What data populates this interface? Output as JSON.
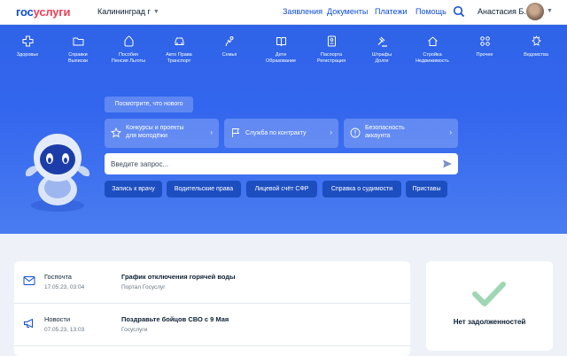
{
  "header": {
    "logo_part1": "гос",
    "logo_part2": "услуги",
    "city": "Калининград г",
    "nav": [
      "Заявления",
      "Документы",
      "Платежи",
      "Помощь"
    ],
    "user_name": "Анастасия Б."
  },
  "categories": [
    {
      "label": "Здоровье",
      "icon": "health-icon"
    },
    {
      "label": "Справки\nВыписки",
      "icon": "folder-icon"
    },
    {
      "label": "Пособия\nПенсия Льготы",
      "icon": "bag-icon"
    },
    {
      "label": "Авто Права\nТранспорт",
      "icon": "car-icon"
    },
    {
      "label": "Семья",
      "icon": "family-icon"
    },
    {
      "label": "Дети\nОбразование",
      "icon": "book-icon"
    },
    {
      "label": "Паспорта\nРегистрация",
      "icon": "passport-icon"
    },
    {
      "label": "Штрафы\nДолги",
      "icon": "gavel-icon"
    },
    {
      "label": "Стройка\nНедвижимость",
      "icon": "house-icon"
    },
    {
      "label": "Прочее",
      "icon": "grid-icon"
    },
    {
      "label": "Ведомства",
      "icon": "emblem-icon"
    }
  ],
  "hero": {
    "whats_new": "Посмотрите, что нового",
    "cards": [
      {
        "text": "Конкурсы и проекты\nдля молодёжи",
        "icon": "star-icon"
      },
      {
        "text": "Служба по контракту",
        "icon": "flag-icon"
      },
      {
        "text": "Безопасность\nаккаунта",
        "icon": "info-icon"
      }
    ],
    "search_placeholder": "Введите запрос...",
    "chips": [
      "Запись к врачу",
      "Водительские права",
      "Лицевой счёт СФР",
      "Справка о судимости",
      "Приставы"
    ]
  },
  "feed": [
    {
      "source": "Госпочта",
      "date": "17.05.23, 03:04",
      "title": "График отключения горячей воды",
      "sub": "Портал Госуслуг",
      "icon": "mail-icon"
    },
    {
      "source": "Новости",
      "date": "07.05.23, 13:03",
      "title": "Поздравьте бойцов СВО с 9 Мая",
      "sub": "Госуслуги",
      "icon": "megaphone-icon"
    }
  ],
  "debt": {
    "text": "Нет задолженностей"
  },
  "colors": {
    "brand_blue": "#0d4cd3",
    "brand_red": "#ee3f58",
    "hero_blue": "#3366ee",
    "check_green": "#9fd6b4"
  }
}
